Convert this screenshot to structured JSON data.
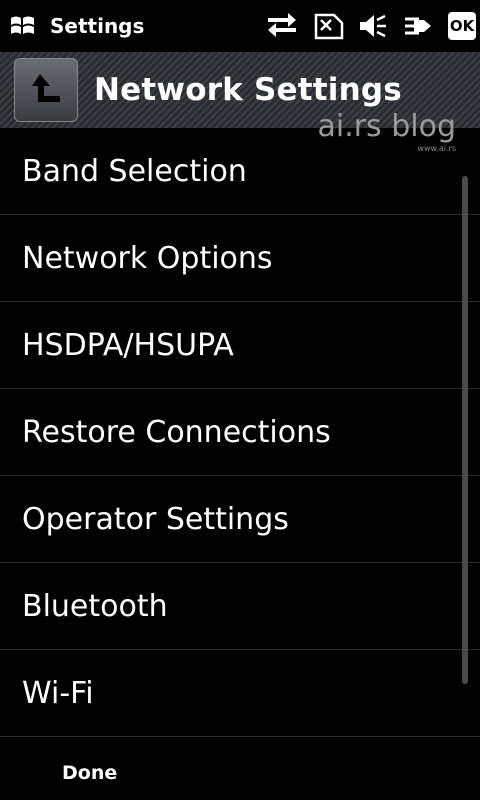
{
  "status_bar": {
    "title": "Settings",
    "icons": [
      "windows-start-icon",
      "data-transfer-icon",
      "no-sim-icon",
      "volume-mute-icon",
      "power-plug-icon"
    ],
    "ok_label": "OK"
  },
  "header": {
    "back_icon": "back-arrow-icon",
    "title": "Network Settings"
  },
  "watermark": {
    "main": "ai.rs blog",
    "sub": "www.ai.rs"
  },
  "list": {
    "items": [
      {
        "label": "Band Selection"
      },
      {
        "label": "Network Options"
      },
      {
        "label": "HSDPA/HSUPA"
      },
      {
        "label": "Restore Connections"
      },
      {
        "label": "Operator Settings"
      },
      {
        "label": "Bluetooth"
      },
      {
        "label": "Wi-Fi"
      }
    ]
  },
  "bottom_bar": {
    "done_label": "Done"
  },
  "colors": {
    "background": "#000000",
    "text": "#ffffff",
    "divider": "#2a2a2a",
    "header_bg": "#33363a"
  }
}
